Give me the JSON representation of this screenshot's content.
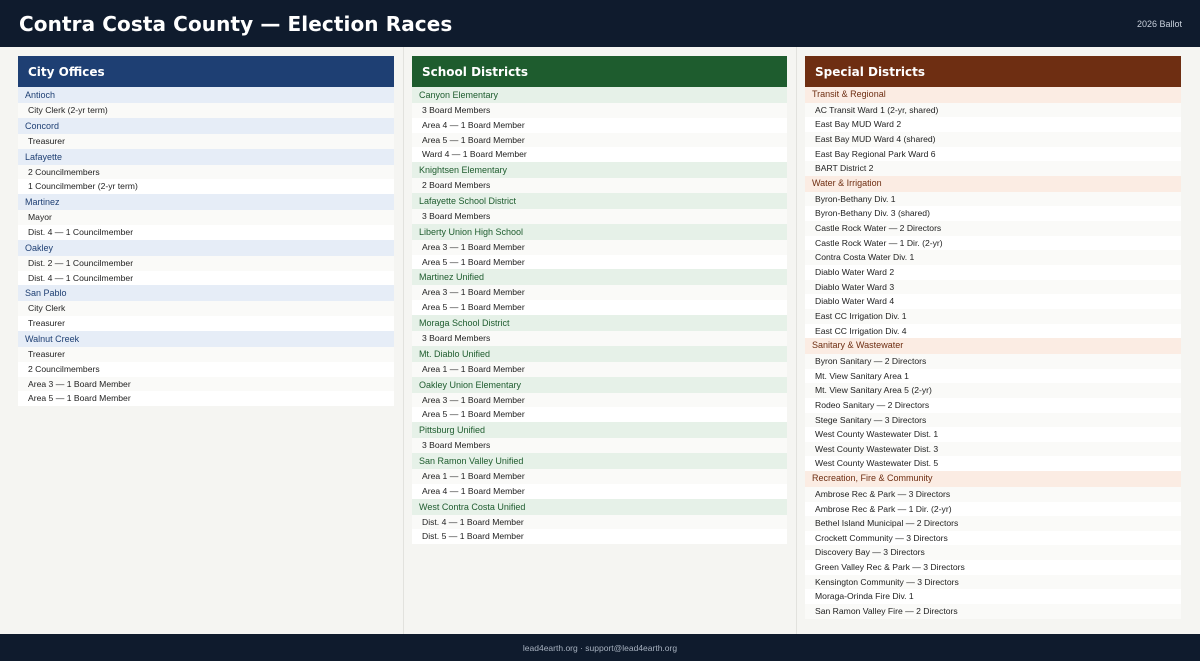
{
  "header": {
    "title": "Contra Costa County — Election Races",
    "tag": "2026 Ballot"
  },
  "columns": [
    {
      "title": "City Offices",
      "groups": [
        {
          "name": "Antioch",
          "items": [
            "City Clerk (2-yr term)"
          ]
        },
        {
          "name": "Concord",
          "items": [
            "Treasurer"
          ]
        },
        {
          "name": "Lafayette",
          "items": [
            "2 Councilmembers",
            "1 Councilmember (2-yr term)"
          ]
        },
        {
          "name": "Martinez",
          "items": [
            "Mayor",
            "Dist. 4 — 1 Councilmember"
          ]
        },
        {
          "name": "Oakley",
          "items": [
            "Dist. 2 — 1 Councilmember",
            "Dist. 4 — 1 Councilmember"
          ]
        },
        {
          "name": "San Pablo",
          "items": [
            "City Clerk",
            "Treasurer"
          ]
        },
        {
          "name": "Walnut Creek",
          "items": [
            "Treasurer",
            "2 Councilmembers",
            "Area 3 — 1 Board Member",
            "Area 5 — 1 Board Member"
          ]
        }
      ]
    },
    {
      "title": "School Districts",
      "groups": [
        {
          "name": "Canyon Elementary",
          "items": [
            "3 Board Members",
            "Area 4 — 1 Board Member",
            "Area 5 — 1 Board Member",
            "Ward 4 — 1 Board Member"
          ]
        },
        {
          "name": "Knightsen Elementary",
          "items": [
            "2 Board Members"
          ]
        },
        {
          "name": "Lafayette School District",
          "items": [
            "3 Board Members"
          ]
        },
        {
          "name": "Liberty Union High School",
          "items": [
            "Area 3 — 1 Board Member",
            "Area 5 — 1 Board Member"
          ]
        },
        {
          "name": "Martinez Unified",
          "items": [
            "Area 3 — 1 Board Member",
            "Area 5 — 1 Board Member"
          ]
        },
        {
          "name": "Moraga School District",
          "items": [
            "3 Board Members"
          ]
        },
        {
          "name": "Mt. Diablo Unified",
          "items": [
            "Area 1 — 1 Board Member"
          ]
        },
        {
          "name": "Oakley Union Elementary",
          "items": [
            "Area 3 — 1 Board Member",
            "Area 5 — 1 Board Member"
          ]
        },
        {
          "name": "Pittsburg Unified",
          "items": [
            "3 Board Members"
          ]
        },
        {
          "name": "San Ramon Valley Unified",
          "items": [
            "Area 1 — 1 Board Member",
            "Area 4 — 1 Board Member"
          ]
        },
        {
          "name": "West Contra Costa Unified",
          "items": [
            "Dist. 4 — 1 Board Member",
            "Dist. 5 — 1 Board Member"
          ]
        }
      ]
    },
    {
      "title": "Special Districts",
      "groups": [
        {
          "name": "Transit & Regional",
          "items": [
            "AC Transit Ward 1 (2-yr, shared)",
            "East Bay MUD Ward 2",
            "East Bay MUD Ward 4 (shared)",
            "East Bay Regional Park Ward 6",
            "BART District 2"
          ]
        },
        {
          "name": "Water & Irrigation",
          "items": [
            "Byron-Bethany Div. 1",
            "Byron-Bethany Div. 3 (shared)",
            "Castle Rock Water — 2 Directors",
            "Castle Rock Water — 1 Dir. (2-yr)",
            "Contra Costa Water Div. 1",
            "Diablo Water Ward 2",
            "Diablo Water Ward 3",
            "Diablo Water Ward 4",
            "East CC Irrigation Div. 1",
            "East CC Irrigation Div. 4"
          ]
        },
        {
          "name": "Sanitary & Wastewater",
          "items": [
            "Byron Sanitary — 2 Directors",
            "Mt. View Sanitary Area 1",
            "Mt. View Sanitary Area 5 (2-yr)",
            "Rodeo Sanitary — 2 Directors",
            "Stege Sanitary — 3 Directors",
            "West County Wastewater Dist. 1",
            "West County Wastewater Dist. 3",
            "West County Wastewater Dist. 5"
          ]
        },
        {
          "name": "Recreation, Fire & Community",
          "items": [
            "Ambrose Rec & Park — 3 Directors",
            "Ambrose Rec & Park — 1 Dir. (2-yr)",
            "Bethel Island Municipal — 2 Directors",
            "Crockett Community — 3 Directors",
            "Discovery Bay — 3 Directors",
            "Green Valley Rec & Park — 3 Directors",
            "Kensington Community — 3 Directors",
            "Moraga-Orinda Fire Div. 1",
            "San Ramon Valley Fire — 2 Directors"
          ]
        }
      ]
    }
  ],
  "footer": {
    "text": "lead4earth.org  ·  support@lead4earth.org"
  }
}
